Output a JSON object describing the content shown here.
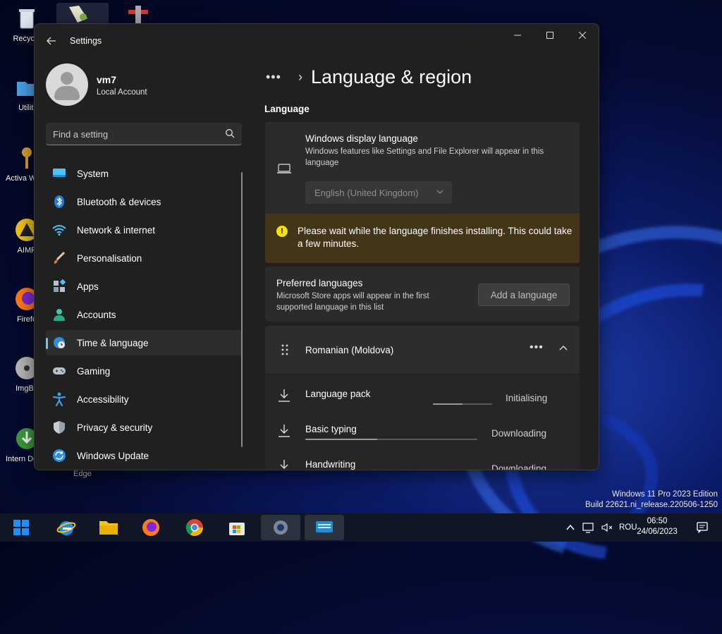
{
  "desktop": {
    "icons": [
      {
        "label": "Recycle",
        "name": "recycle-bin"
      },
      {
        "label": "Utiliti",
        "name": "utilities-folder"
      },
      {
        "label": "Activa Windo",
        "name": "activate-windows"
      },
      {
        "label": "AIMP",
        "name": "aimp"
      },
      {
        "label": "Firefo",
        "name": "firefox"
      },
      {
        "label": "ImgBu",
        "name": "imgburn"
      },
      {
        "label": "Intern Downlo",
        "name": "internet-download-manager"
      }
    ],
    "edge_label": "Edge",
    "watermark": {
      "line1": "Windows 11 Pro 2023 Edition",
      "line2": "Build 22621.ni_release.220506-1250"
    }
  },
  "window": {
    "title": "Settings",
    "controls": {
      "minimize": "—",
      "maximize": "☐",
      "close": "✕"
    }
  },
  "user": {
    "name": "vm7",
    "account_type": "Local Account"
  },
  "search": {
    "placeholder": "Find a setting"
  },
  "nav": {
    "items": [
      {
        "label": "System",
        "icon": "system-icon"
      },
      {
        "label": "Bluetooth & devices",
        "icon": "bluetooth-icon"
      },
      {
        "label": "Network & internet",
        "icon": "wifi-icon"
      },
      {
        "label": "Personalisation",
        "icon": "brush-icon"
      },
      {
        "label": "Apps",
        "icon": "apps-icon"
      },
      {
        "label": "Accounts",
        "icon": "accounts-icon"
      },
      {
        "label": "Time & language",
        "icon": "globe-clock-icon",
        "active": true
      },
      {
        "label": "Gaming",
        "icon": "gamepad-icon"
      },
      {
        "label": "Accessibility",
        "icon": "accessibility-icon"
      },
      {
        "label": "Privacy & security",
        "icon": "shield-icon"
      },
      {
        "label": "Windows Update",
        "icon": "update-icon"
      }
    ]
  },
  "page": {
    "breadcrumb_more": "•••",
    "breadcrumb_sep": "›",
    "title": "Language & region",
    "section_language": "Language"
  },
  "display_language": {
    "title": "Windows display language",
    "description": "Windows features like Settings and File Explorer will appear in this language",
    "selected": "English (United Kingdom)"
  },
  "warning": {
    "text": "Please wait while the language finishes installing. This could take a few minutes."
  },
  "preferred": {
    "title": "Preferred languages",
    "description": "Microsoft Store apps will appear in the first supported language in this list",
    "add_button": "Add a language"
  },
  "language_entry": {
    "name": "Romanian (Moldova)",
    "more": "•••"
  },
  "features": [
    {
      "name": "Language pack",
      "status": "Initialising",
      "progress": 0.5
    },
    {
      "name": "Basic typing",
      "status": "Downloading",
      "progress": 0.42
    },
    {
      "name": "Handwriting",
      "status": "Downloading",
      "progress": 0.0
    }
  ],
  "taskbar": {
    "tray": {
      "language": "ROU"
    },
    "clock": {
      "time": "06:50",
      "date": "24/06/2023"
    }
  },
  "colors": {
    "accent": "#60cdff",
    "warning_bg": "#433519",
    "warning_icon": "#fce100"
  }
}
